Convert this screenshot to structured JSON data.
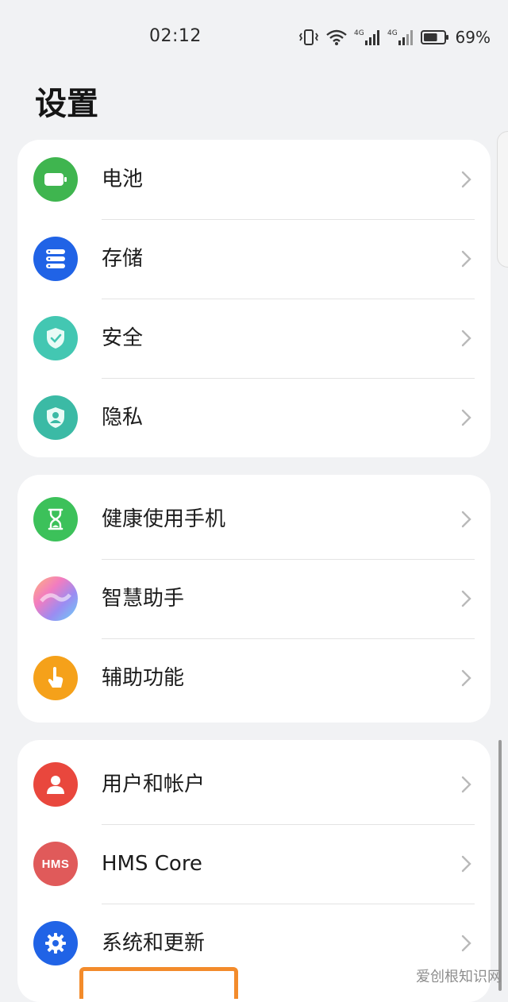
{
  "status_bar": {
    "time": "02:12",
    "battery_percent": "69%",
    "network_label": "4G",
    "battery_level": 0.69,
    "icons": [
      "vibrate-icon",
      "wifi-icon",
      "signal-icon",
      "signal-icon",
      "battery-icon"
    ]
  },
  "page": {
    "title": "设置"
  },
  "groups": [
    {
      "items": [
        {
          "label": "电池",
          "icon": "battery-icon",
          "color": "#3fb54f"
        },
        {
          "label": "存储",
          "icon": "storage-icon",
          "color": "#2063e6"
        },
        {
          "label": "安全",
          "icon": "shield-icon",
          "color": "#43c7b2"
        },
        {
          "label": "隐私",
          "icon": "privacy-icon",
          "color": "#3bbaa5"
        }
      ]
    },
    {
      "items": [
        {
          "label": "健康使用手机",
          "icon": "hourglass-icon",
          "color": "#3cc15a"
        },
        {
          "label": "智慧助手",
          "icon": "assistant-icon",
          "color": "#b77ad9"
        },
        {
          "label": "辅助功能",
          "icon": "accessibility-hand-icon",
          "color": "#f5a11a"
        }
      ]
    },
    {
      "items": [
        {
          "label": "用户和帐户",
          "icon": "user-icon",
          "color": "#e9473d"
        },
        {
          "label": "HMS Core",
          "icon": "hms-icon",
          "color": "#e05a5a",
          "icon_text": "HMS"
        },
        {
          "label": "系统和更新",
          "icon": "gear-icon",
          "color": "#2063e6"
        }
      ]
    }
  ],
  "watermark": "爱创根知识网"
}
